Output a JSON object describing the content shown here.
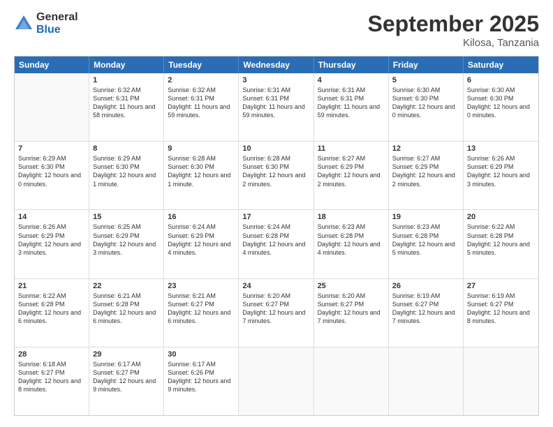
{
  "logo": {
    "general": "General",
    "blue": "Blue"
  },
  "title": {
    "month": "September 2025",
    "location": "Kilosa, Tanzania"
  },
  "header_days": [
    "Sunday",
    "Monday",
    "Tuesday",
    "Wednesday",
    "Thursday",
    "Friday",
    "Saturday"
  ],
  "weeks": [
    [
      {
        "day": "",
        "sunrise": "",
        "sunset": "",
        "daylight": "",
        "empty": true
      },
      {
        "day": "1",
        "sunrise": "Sunrise: 6:32 AM",
        "sunset": "Sunset: 6:31 PM",
        "daylight": "Daylight: 11 hours and 58 minutes.",
        "empty": false
      },
      {
        "day": "2",
        "sunrise": "Sunrise: 6:32 AM",
        "sunset": "Sunset: 6:31 PM",
        "daylight": "Daylight: 11 hours and 59 minutes.",
        "empty": false
      },
      {
        "day": "3",
        "sunrise": "Sunrise: 6:31 AM",
        "sunset": "Sunset: 6:31 PM",
        "daylight": "Daylight: 11 hours and 59 minutes.",
        "empty": false
      },
      {
        "day": "4",
        "sunrise": "Sunrise: 6:31 AM",
        "sunset": "Sunset: 6:31 PM",
        "daylight": "Daylight: 11 hours and 59 minutes.",
        "empty": false
      },
      {
        "day": "5",
        "sunrise": "Sunrise: 6:30 AM",
        "sunset": "Sunset: 6:30 PM",
        "daylight": "Daylight: 12 hours and 0 minutes.",
        "empty": false
      },
      {
        "day": "6",
        "sunrise": "Sunrise: 6:30 AM",
        "sunset": "Sunset: 6:30 PM",
        "daylight": "Daylight: 12 hours and 0 minutes.",
        "empty": false
      }
    ],
    [
      {
        "day": "7",
        "sunrise": "Sunrise: 6:29 AM",
        "sunset": "Sunset: 6:30 PM",
        "daylight": "Daylight: 12 hours and 0 minutes.",
        "empty": false
      },
      {
        "day": "8",
        "sunrise": "Sunrise: 6:29 AM",
        "sunset": "Sunset: 6:30 PM",
        "daylight": "Daylight: 12 hours and 1 minute.",
        "empty": false
      },
      {
        "day": "9",
        "sunrise": "Sunrise: 6:28 AM",
        "sunset": "Sunset: 6:30 PM",
        "daylight": "Daylight: 12 hours and 1 minute.",
        "empty": false
      },
      {
        "day": "10",
        "sunrise": "Sunrise: 6:28 AM",
        "sunset": "Sunset: 6:30 PM",
        "daylight": "Daylight: 12 hours and 2 minutes.",
        "empty": false
      },
      {
        "day": "11",
        "sunrise": "Sunrise: 6:27 AM",
        "sunset": "Sunset: 6:29 PM",
        "daylight": "Daylight: 12 hours and 2 minutes.",
        "empty": false
      },
      {
        "day": "12",
        "sunrise": "Sunrise: 6:27 AM",
        "sunset": "Sunset: 6:29 PM",
        "daylight": "Daylight: 12 hours and 2 minutes.",
        "empty": false
      },
      {
        "day": "13",
        "sunrise": "Sunrise: 6:26 AM",
        "sunset": "Sunset: 6:29 PM",
        "daylight": "Daylight: 12 hours and 3 minutes.",
        "empty": false
      }
    ],
    [
      {
        "day": "14",
        "sunrise": "Sunrise: 6:26 AM",
        "sunset": "Sunset: 6:29 PM",
        "daylight": "Daylight: 12 hours and 3 minutes.",
        "empty": false
      },
      {
        "day": "15",
        "sunrise": "Sunrise: 6:25 AM",
        "sunset": "Sunset: 6:29 PM",
        "daylight": "Daylight: 12 hours and 3 minutes.",
        "empty": false
      },
      {
        "day": "16",
        "sunrise": "Sunrise: 6:24 AM",
        "sunset": "Sunset: 6:29 PM",
        "daylight": "Daylight: 12 hours and 4 minutes.",
        "empty": false
      },
      {
        "day": "17",
        "sunrise": "Sunrise: 6:24 AM",
        "sunset": "Sunset: 6:28 PM",
        "daylight": "Daylight: 12 hours and 4 minutes.",
        "empty": false
      },
      {
        "day": "18",
        "sunrise": "Sunrise: 6:23 AM",
        "sunset": "Sunset: 6:28 PM",
        "daylight": "Daylight: 12 hours and 4 minutes.",
        "empty": false
      },
      {
        "day": "19",
        "sunrise": "Sunrise: 6:23 AM",
        "sunset": "Sunset: 6:28 PM",
        "daylight": "Daylight: 12 hours and 5 minutes.",
        "empty": false
      },
      {
        "day": "20",
        "sunrise": "Sunrise: 6:22 AM",
        "sunset": "Sunset: 6:28 PM",
        "daylight": "Daylight: 12 hours and 5 minutes.",
        "empty": false
      }
    ],
    [
      {
        "day": "21",
        "sunrise": "Sunrise: 6:22 AM",
        "sunset": "Sunset: 6:28 PM",
        "daylight": "Daylight: 12 hours and 6 minutes.",
        "empty": false
      },
      {
        "day": "22",
        "sunrise": "Sunrise: 6:21 AM",
        "sunset": "Sunset: 6:28 PM",
        "daylight": "Daylight: 12 hours and 6 minutes.",
        "empty": false
      },
      {
        "day": "23",
        "sunrise": "Sunrise: 6:21 AM",
        "sunset": "Sunset: 6:27 PM",
        "daylight": "Daylight: 12 hours and 6 minutes.",
        "empty": false
      },
      {
        "day": "24",
        "sunrise": "Sunrise: 6:20 AM",
        "sunset": "Sunset: 6:27 PM",
        "daylight": "Daylight: 12 hours and 7 minutes.",
        "empty": false
      },
      {
        "day": "25",
        "sunrise": "Sunrise: 6:20 AM",
        "sunset": "Sunset: 6:27 PM",
        "daylight": "Daylight: 12 hours and 7 minutes.",
        "empty": false
      },
      {
        "day": "26",
        "sunrise": "Sunrise: 6:19 AM",
        "sunset": "Sunset: 6:27 PM",
        "daylight": "Daylight: 12 hours and 7 minutes.",
        "empty": false
      },
      {
        "day": "27",
        "sunrise": "Sunrise: 6:19 AM",
        "sunset": "Sunset: 6:27 PM",
        "daylight": "Daylight: 12 hours and 8 minutes.",
        "empty": false
      }
    ],
    [
      {
        "day": "28",
        "sunrise": "Sunrise: 6:18 AM",
        "sunset": "Sunset: 6:27 PM",
        "daylight": "Daylight: 12 hours and 8 minutes.",
        "empty": false
      },
      {
        "day": "29",
        "sunrise": "Sunrise: 6:17 AM",
        "sunset": "Sunset: 6:27 PM",
        "daylight": "Daylight: 12 hours and 9 minutes.",
        "empty": false
      },
      {
        "day": "30",
        "sunrise": "Sunrise: 6:17 AM",
        "sunset": "Sunset: 6:26 PM",
        "daylight": "Daylight: 12 hours and 9 minutes.",
        "empty": false
      },
      {
        "day": "",
        "sunrise": "",
        "sunset": "",
        "daylight": "",
        "empty": true
      },
      {
        "day": "",
        "sunrise": "",
        "sunset": "",
        "daylight": "",
        "empty": true
      },
      {
        "day": "",
        "sunrise": "",
        "sunset": "",
        "daylight": "",
        "empty": true
      },
      {
        "day": "",
        "sunrise": "",
        "sunset": "",
        "daylight": "",
        "empty": true
      }
    ]
  ]
}
